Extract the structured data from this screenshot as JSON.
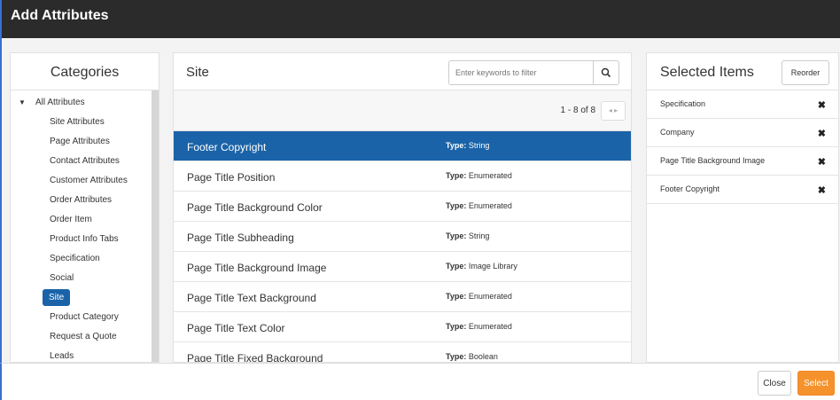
{
  "window": {
    "title": "Add Attributes"
  },
  "categories": {
    "header": "Categories",
    "root_label": "All Attributes",
    "items": [
      "Site Attributes",
      "Page Attributes",
      "Contact Attributes",
      "Customer Attributes",
      "Order Attributes",
      "Order Item",
      "Product Info Tabs",
      "Specification",
      "Social",
      "Site",
      "Product Category",
      "Request a Quote",
      "Leads"
    ],
    "active": "Site"
  },
  "site": {
    "title": "Site",
    "filter_placeholder": "Enter keywords to filter",
    "pager_text": "1 - 8 of 8",
    "type_label": "Type:",
    "rows": [
      {
        "name": "Footer Copyright",
        "type": "String",
        "selected": true
      },
      {
        "name": "Page Title Position",
        "type": "Enumerated"
      },
      {
        "name": "Page Title Background Color",
        "type": "Enumerated"
      },
      {
        "name": "Page Title Subheading",
        "type": "String"
      },
      {
        "name": "Page Title Background Image",
        "type": "Image Library"
      },
      {
        "name": "Page Title Text Background",
        "type": "Enumerated"
      },
      {
        "name": "Page Title Text Color",
        "type": "Enumerated"
      },
      {
        "name": "Page Title Fixed Background",
        "type": "Boolean"
      }
    ]
  },
  "selected": {
    "title": "Selected Items",
    "reorder_label": "Reorder",
    "items": [
      "Specification",
      "Company",
      "Page Title Background Image",
      "Footer Copyright"
    ]
  },
  "footer": {
    "close_label": "Close",
    "select_label": "Select"
  },
  "colors": {
    "accent": "#1a63a8",
    "select_button": "#f5922c",
    "titlebar": "#2b2b2b"
  }
}
